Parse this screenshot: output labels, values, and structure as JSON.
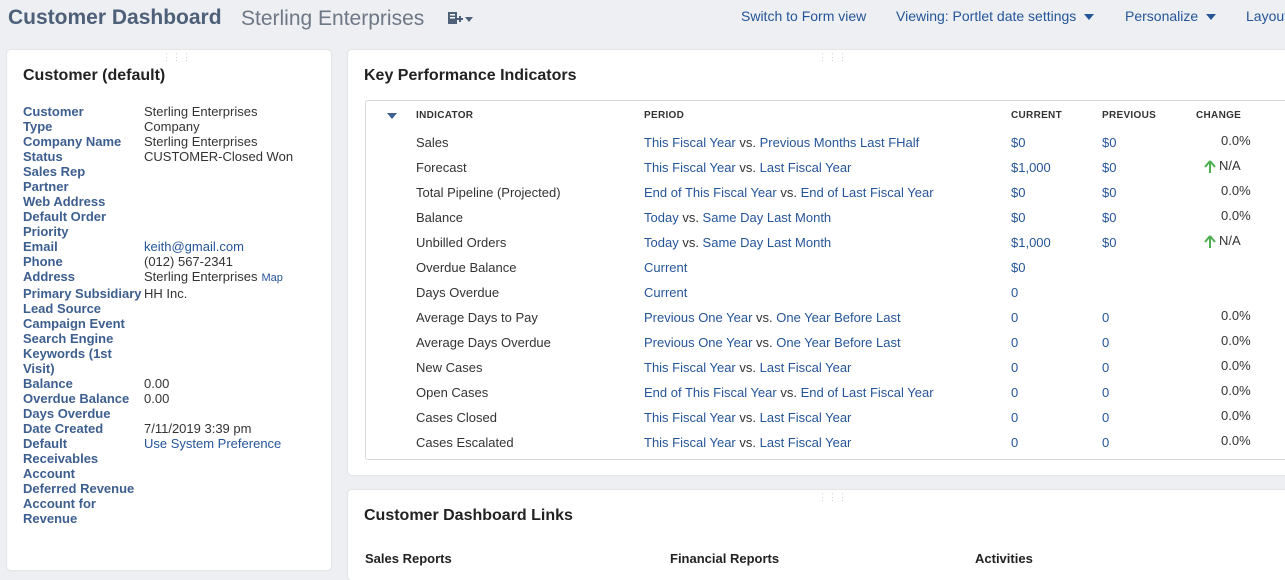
{
  "header": {
    "title": "Customer Dashboard",
    "subtitle": "Sterling Enterprises",
    "nav": {
      "switch_form": "Switch to Form view",
      "viewing": "Viewing: Portlet date settings",
      "personalize": "Personalize",
      "layout": "Layout"
    }
  },
  "customer": {
    "title": "Customer (default)",
    "fields": [
      {
        "label": "Customer",
        "value": "Sterling Enterprises"
      },
      {
        "label": "Type",
        "value": "Company"
      },
      {
        "label": "Company Name",
        "value": "Sterling Enterprises"
      },
      {
        "label": "Status",
        "value": "CUSTOMER-Closed Won"
      },
      {
        "label": "Sales Rep",
        "value": ""
      },
      {
        "label": "Partner",
        "value": ""
      },
      {
        "label": "Web Address",
        "value": ""
      },
      {
        "label": "Default Order Priority",
        "value": ""
      },
      {
        "label": "Email",
        "value": "keith@gmail.com"
      },
      {
        "label": "Phone",
        "value": "(012) 567-2341"
      },
      {
        "label": "Address",
        "value": "Sterling Enterprises",
        "extra": "Map"
      },
      {
        "label": "Primary Subsidiary",
        "value": "HH Inc."
      },
      {
        "label": "Lead Source",
        "value": ""
      },
      {
        "label": "Campaign Event",
        "value": ""
      },
      {
        "label": "Search Engine Keywords (1st Visit)",
        "value": ""
      },
      {
        "label": "Balance",
        "value": "0.00"
      },
      {
        "label": "Overdue Balance",
        "value": "0.00"
      },
      {
        "label": "Days Overdue",
        "value": ""
      },
      {
        "label": "Date Created",
        "value": "7/11/2019 3:39 pm"
      },
      {
        "label": "Default Receivables Account",
        "value": "Use System Preference"
      },
      {
        "label": "Deferred Revenue Account for Revenue",
        "value": ""
      }
    ]
  },
  "kpi": {
    "title": "Key Performance Indicators",
    "columns": {
      "indicator": "INDICATOR",
      "period": "PERIOD",
      "current": "CURRENT",
      "previous": "PREVIOUS",
      "change": "CHANGE"
    },
    "rows": [
      {
        "indicator": "Sales",
        "p1": "This Fiscal Year",
        "vs": " vs. ",
        "p2": "Previous Months Last FHalf",
        "current": "$0",
        "previous": "$0",
        "change": "0.0%",
        "up": false
      },
      {
        "indicator": "Forecast",
        "p1": "This Fiscal Year",
        "vs": " vs. ",
        "p2": "Last Fiscal Year",
        "current": "$1,000",
        "previous": "$0",
        "change": "N/A",
        "up": true
      },
      {
        "indicator": "Total Pipeline (Projected)",
        "p1": "End of This Fiscal Year",
        "vs": " vs. ",
        "p2": "End of Last Fiscal Year",
        "current": "$0",
        "previous": "$0",
        "change": "0.0%",
        "up": false
      },
      {
        "indicator": "Balance",
        "p1": "Today",
        "vs": " vs. ",
        "p2": "Same Day Last Month",
        "current": "$0",
        "previous": "$0",
        "change": "0.0%",
        "up": false
      },
      {
        "indicator": "Unbilled Orders",
        "p1": "Today",
        "vs": " vs. ",
        "p2": "Same Day Last Month",
        "current": "$1,000",
        "previous": "$0",
        "change": "N/A",
        "up": true
      },
      {
        "indicator": "Overdue Balance",
        "p1": "Current",
        "vs": "",
        "p2": "",
        "current": "$0",
        "previous": "",
        "change": "",
        "up": false
      },
      {
        "indicator": "Days Overdue",
        "p1": "Current",
        "vs": "",
        "p2": "",
        "current": "0",
        "previous": "",
        "change": "",
        "up": false
      },
      {
        "indicator": "Average Days to Pay",
        "p1": "Previous One Year",
        "vs": " vs. ",
        "p2": "One Year Before Last",
        "current": "0",
        "previous": "0",
        "change": "0.0%",
        "up": false
      },
      {
        "indicator": "Average Days Overdue",
        "p1": "Previous One Year",
        "vs": " vs. ",
        "p2": "One Year Before Last",
        "current": "0",
        "previous": "0",
        "change": "0.0%",
        "up": false
      },
      {
        "indicator": "New Cases",
        "p1": "This Fiscal Year",
        "vs": " vs. ",
        "p2": "Last Fiscal Year",
        "current": "0",
        "previous": "0",
        "change": "0.0%",
        "up": false
      },
      {
        "indicator": "Open Cases",
        "p1": "End of This Fiscal Year",
        "vs": " vs. ",
        "p2": "End of Last Fiscal Year",
        "current": "0",
        "previous": "0",
        "change": "0.0%",
        "up": false
      },
      {
        "indicator": "Cases Closed",
        "p1": "This Fiscal Year",
        "vs": " vs. ",
        "p2": "Last Fiscal Year",
        "current": "0",
        "previous": "0",
        "change": "0.0%",
        "up": false
      },
      {
        "indicator": "Cases Escalated",
        "p1": "This Fiscal Year",
        "vs": " vs. ",
        "p2": "Last Fiscal Year",
        "current": "0",
        "previous": "0",
        "change": "0.0%",
        "up": false
      }
    ]
  },
  "links": {
    "title": "Customer Dashboard Links",
    "groups": [
      "Sales Reports",
      "Financial Reports",
      "Activities"
    ]
  },
  "colors": {
    "link": "#255599",
    "label": "#3d5f8f",
    "up_arrow": "#4caf50"
  }
}
